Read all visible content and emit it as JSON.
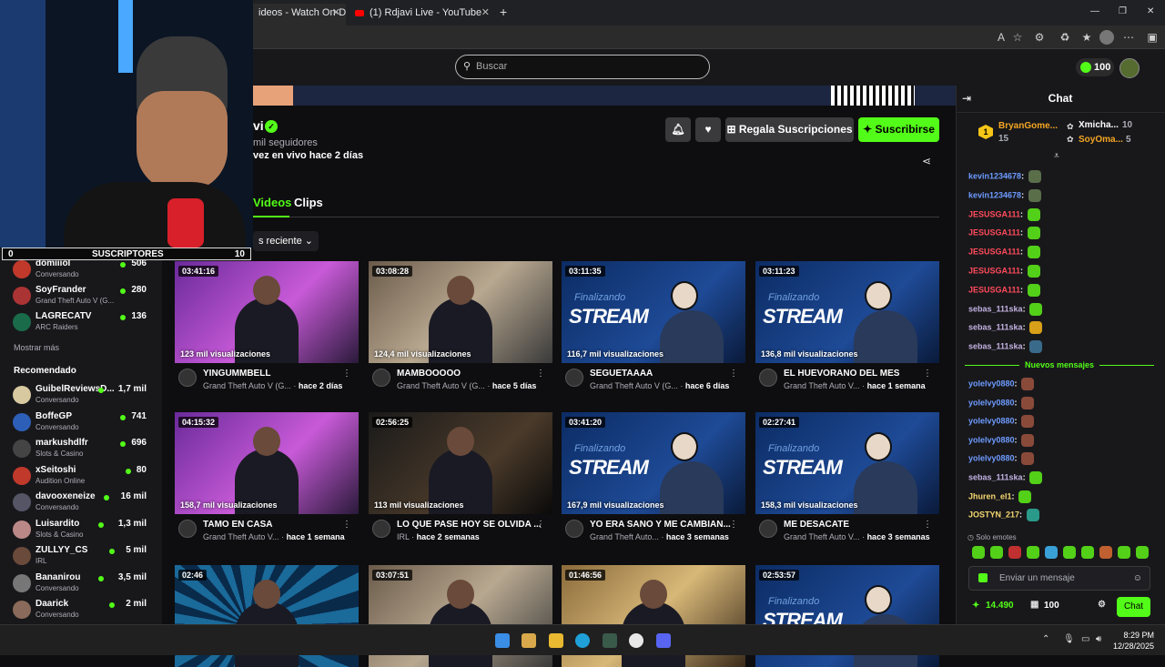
{
  "browser": {
    "tabs": [
      {
        "title": "ideos - Watch On-Deman"
      },
      {
        "title": "(1) Rdjavi Live - YouTube"
      }
    ],
    "new_tab": "+",
    "window_controls": [
      "—",
      "❐",
      "✕"
    ]
  },
  "header": {
    "search_placeholder": "Buscar",
    "coins": "100"
  },
  "channel": {
    "name": "vi",
    "followers": "mil seguidores",
    "last_live": "vez en vivo hace 2 días",
    "gift_label": "Regala Suscripciones",
    "subscribe_label": "Suscribirse"
  },
  "tabs": {
    "videos": "Videos",
    "clips": "Clips"
  },
  "sort_label": "s reciente",
  "videos": [
    {
      "duration": "03:41:16",
      "views": "123 mil visualizaciones",
      "title": "YINGUMMBELL",
      "category": "Grand Theft Auto V (G...",
      "ago": "hace 2 días",
      "style": "pink"
    },
    {
      "duration": "03:08:28",
      "views": "124,4 mil visualizaciones",
      "title": "MAMBOOOOO",
      "category": "Grand Theft Auto V (G...",
      "ago": "hace 5 días",
      "style": "room"
    },
    {
      "duration": "03:11:35",
      "views": "116,7 mil visualizaciones",
      "title": "SEGUETAAAA",
      "category": "Grand Theft Auto V (G...",
      "ago": "hace 6 días",
      "style": "stream"
    },
    {
      "duration": "03:11:23",
      "views": "136,8 mil visualizaciones",
      "title": "EL HUEVORANO DEL MES",
      "category": "Grand Theft Auto V...",
      "ago": "hace 1 semana",
      "style": "stream"
    },
    {
      "duration": "04:15:32",
      "views": "158,7 mil visualizaciones",
      "title": "TAMO EN CASA",
      "category": "Grand Theft Auto V...",
      "ago": "hace 1 semana",
      "style": "pink"
    },
    {
      "duration": "02:56:25",
      "views": "113 mil visualizaciones",
      "title": "LO QUE PASE HOY SE OLVIDA ...",
      "category": "IRL",
      "ago": "hace 2 semanas",
      "style": "night"
    },
    {
      "duration": "03:41:20",
      "views": "167,9 mil visualizaciones",
      "title": "YO ERA SANO Y ME CAMBIAN...",
      "category": "Grand Theft Auto...",
      "ago": "hace 3 semanas",
      "style": "stream"
    },
    {
      "duration": "02:27:41",
      "views": "158,3 mil visualizaciones",
      "title": "ME DESACATE",
      "category": "Grand Theft Auto V...",
      "ago": "hace 3 semanas",
      "style": "stream"
    },
    {
      "duration": "02:46",
      "views": "",
      "title": "",
      "category": "",
      "ago": "",
      "style": "burst"
    },
    {
      "duration": "03:07:51",
      "views": "",
      "title": "",
      "category": "",
      "ago": "",
      "style": "room"
    },
    {
      "duration": "01:46:56",
      "views": "",
      "title": "",
      "category": "",
      "ago": "",
      "style": "warm"
    },
    {
      "duration": "02:53:57",
      "views": "",
      "title": "",
      "category": "",
      "ago": "",
      "style": "stream"
    }
  ],
  "stream_overlay": {
    "small": "Finalizando",
    "big": "STREAM"
  },
  "webcam_overlay": {
    "left": "0",
    "label": "SUSCRIPTORES",
    "right": "10"
  },
  "sidebar": {
    "following": [
      {
        "name": "domiiiol",
        "category": "Conversando",
        "count": "506",
        "color": "#c0392b"
      },
      {
        "name": "SoyFrander",
        "category": "Grand Theft Auto V (G...",
        "count": "280",
        "color": "#a33"
      },
      {
        "name": "LAGRECATV",
        "category": "ARC Raiders",
        "count": "136",
        "color": "#1a6b4a"
      }
    ],
    "show_more": "Mostrar más",
    "recommended_title": "Recomendado",
    "recommended": [
      {
        "name": "GuibelReviewsD...",
        "category": "Conversando",
        "count": "1,7 mil",
        "color": "#d8c9a0"
      },
      {
        "name": "BoffeGP",
        "category": "Conversando",
        "count": "741",
        "color": "#2d5fb8"
      },
      {
        "name": "markushdlfr",
        "category": "Slots & Casino",
        "count": "696",
        "color": "#444"
      },
      {
        "name": "xSeitoshi",
        "category": "Audition Online",
        "count": "80",
        "color": "#c0392b"
      },
      {
        "name": "davooxeneize",
        "category": "Conversando",
        "count": "16 mil",
        "color": "#556"
      },
      {
        "name": "Luisardito",
        "category": "Slots & Casino",
        "count": "1,3 mil",
        "color": "#b88"
      },
      {
        "name": "ZULLYY_CS",
        "category": "IRL",
        "count": "5 mil",
        "color": "#6a4a3a"
      },
      {
        "name": "Bananirou",
        "category": "Conversando",
        "count": "3,5 mil",
        "color": "#777"
      },
      {
        "name": "Daarick",
        "category": "Conversando",
        "count": "2 mil",
        "color": "#8a6a5a"
      }
    ]
  },
  "chat": {
    "title": "Chat",
    "gifters": [
      {
        "rank": "1",
        "name": "BryanGome...",
        "count": "15"
      },
      {
        "name": "Xmicha...",
        "count": "10"
      },
      {
        "name": "SoyOma...",
        "count": "5"
      }
    ],
    "messages": [
      {
        "user": "kevin1234678",
        "color": "#6e9bff",
        "emote": "#5a6e4a"
      },
      {
        "user": "kevin1234678",
        "color": "#6e9bff",
        "emote": "#5a6e4a"
      },
      {
        "user": "JESUSGA111",
        "color": "#ff4a5a",
        "emote": "#53d018"
      },
      {
        "user": "JESUSGA111",
        "color": "#ff4a5a",
        "emote": "#53d018"
      },
      {
        "user": "JESUSGA111",
        "color": "#ff4a5a",
        "emote": "#53d018"
      },
      {
        "user": "JESUSGA111",
        "color": "#ff4a5a",
        "emote": "#53d018"
      },
      {
        "user": "JESUSGA111",
        "color": "#ff4a5a",
        "emote": "#53d018"
      },
      {
        "user": "sebas_111ska",
        "color": "#c3b1e1",
        "emote": "#53d018"
      },
      {
        "user": "sebas_111ska",
        "color": "#c3b1e1",
        "emote": "#d8a018"
      },
      {
        "user": "sebas_111ska",
        "color": "#c3b1e1",
        "emote": "#3a6a8a"
      }
    ],
    "new_messages": "Nuevos mensajes",
    "messages2": [
      {
        "user": "yolelvy0880",
        "color": "#6e9bff",
        "emote": "#8a4a3a"
      },
      {
        "user": "yolelvy0880",
        "color": "#6e9bff",
        "emote": "#8a4a3a"
      },
      {
        "user": "yolelvy0880",
        "color": "#6e9bff",
        "emote": "#8a4a3a"
      },
      {
        "user": "yolelvy0880",
        "color": "#6e9bff",
        "emote": "#8a4a3a"
      },
      {
        "user": "yolelvy0880",
        "color": "#6e9bff",
        "emote": "#8a4a3a"
      },
      {
        "user": "sebas_111ska",
        "color": "#c3b1e1",
        "emote": "#53d018"
      },
      {
        "user": "Jhuren_el1",
        "color": "#f5d76e",
        "emote": "#53d018"
      },
      {
        "user": "JOSTYN_217",
        "color": "#f5d76e",
        "emote": "#2a9a8a"
      }
    ],
    "solo_emotes": "Solo emotes",
    "input_placeholder": "Enviar un mensaje",
    "points": "14.490",
    "gifts": "100",
    "send_label": "Chat"
  },
  "clock": {
    "time": "8:29 PM",
    "date": "12/28/2025"
  }
}
